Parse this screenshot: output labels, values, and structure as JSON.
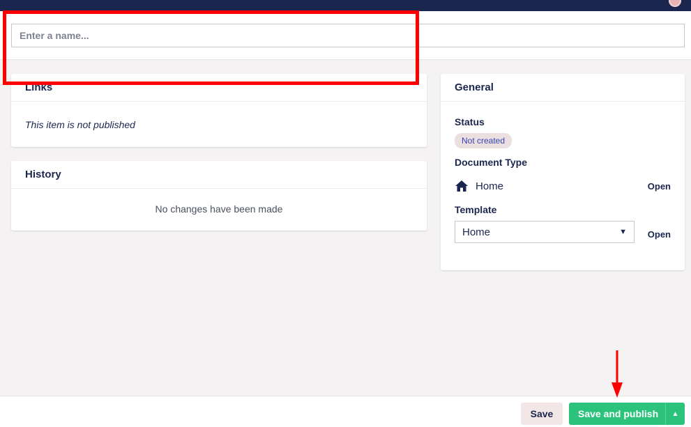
{
  "name_field": {
    "placeholder": "Enter a name...",
    "value": ""
  },
  "links_card": {
    "title": "Links",
    "message": "This item is not published"
  },
  "history_card": {
    "title": "History",
    "message": "No changes have been made"
  },
  "general_card": {
    "title": "General",
    "status_label": "Status",
    "status_badge": "Not created",
    "doctype_label": "Document Type",
    "doctype_value": "Home",
    "doctype_open": "Open",
    "template_label": "Template",
    "template_selected": "Home",
    "template_open": "Open"
  },
  "footer": {
    "save_label": "Save",
    "publish_label": "Save and publish"
  },
  "colors": {
    "accent": "#2bc37c",
    "header": "#1b264f",
    "annotation": "#ff0000"
  }
}
